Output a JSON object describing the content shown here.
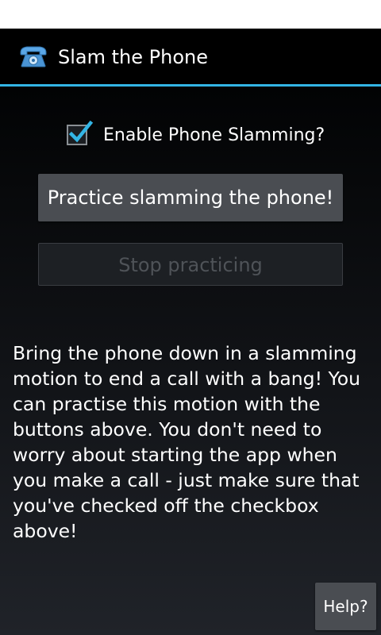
{
  "app": {
    "title": "Slam the Phone",
    "icon": "telephone-icon",
    "accent_color": "#33b5e5"
  },
  "settings": {
    "enable_slamming_label": "Enable Phone Slamming?",
    "enable_slamming_checked": true
  },
  "buttons": {
    "practice_label": "Practice slamming the phone!",
    "stop_label": "Stop practicing",
    "stop_enabled": false,
    "help_label": "Help?"
  },
  "description": "Bring the phone down in a slamming motion to end a call with a bang! You can practise this motion with the buttons above. You don't need to worry about starting the app when you make a call - just make sure that you've checked off the checkbox above!"
}
